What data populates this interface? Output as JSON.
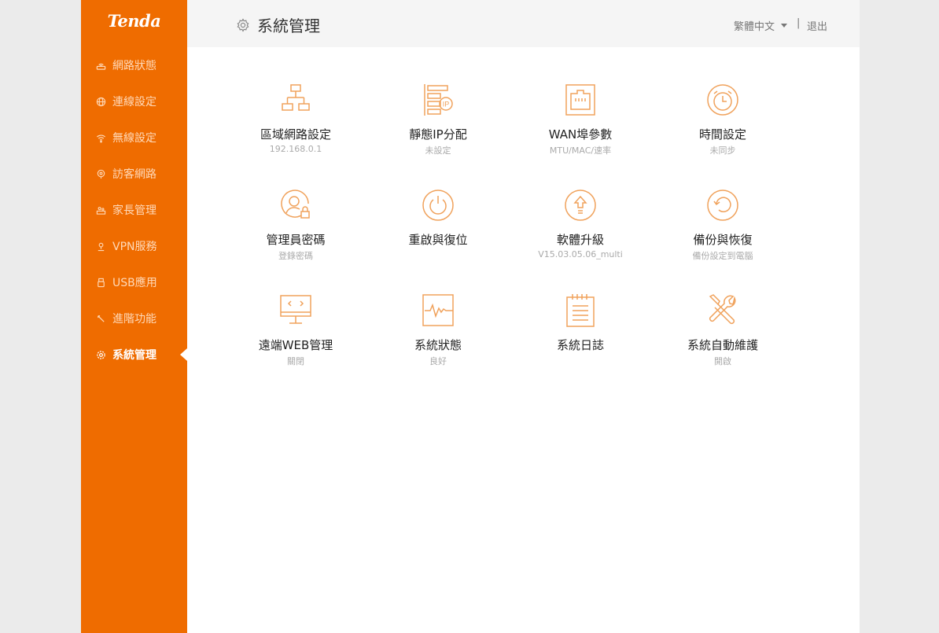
{
  "brand": {
    "logo": "Tenda",
    "accent": "#ef6c00",
    "icon_color": "#f0a25c"
  },
  "sidebar": {
    "items": [
      {
        "label": "網路狀態",
        "icon": "router-icon",
        "active": false
      },
      {
        "label": "連線設定",
        "icon": "globe-icon",
        "active": false
      },
      {
        "label": "無線設定",
        "icon": "wifi-icon",
        "active": false
      },
      {
        "label": "訪客網路",
        "icon": "guest-icon",
        "active": false
      },
      {
        "label": "家長管理",
        "icon": "parental-icon",
        "active": false
      },
      {
        "label": "VPN服務",
        "icon": "vpn-icon",
        "active": false
      },
      {
        "label": "USB應用",
        "icon": "usb-icon",
        "active": false
      },
      {
        "label": "進階功能",
        "icon": "tools-icon",
        "active": false
      },
      {
        "label": "系統管理",
        "icon": "gear-icon",
        "active": true
      }
    ]
  },
  "header": {
    "title": "系統管理",
    "language": "繁體中文",
    "separator": "|",
    "logout": "退出"
  },
  "tiles": [
    {
      "label": "區域網路設定",
      "sub": "192.168.0.1",
      "icon": "lan-topology-icon"
    },
    {
      "label": "靜態IP分配",
      "sub": "未設定",
      "icon": "static-ip-icon"
    },
    {
      "label": "WAN埠參數",
      "sub": "MTU/MAC/速率",
      "icon": "ethernet-port-icon"
    },
    {
      "label": "時間設定",
      "sub": "未同步",
      "icon": "alarm-clock-icon"
    },
    {
      "label": "管理員密碼",
      "sub": "登錄密碼",
      "icon": "admin-lock-icon"
    },
    {
      "label": "重啟與復位",
      "sub": "",
      "icon": "power-icon"
    },
    {
      "label": "軟體升級",
      "sub": "V15.03.05.06_multi",
      "icon": "upgrade-arrow-icon"
    },
    {
      "label": "備份與恢復",
      "sub": "備份設定到電腦",
      "icon": "restore-icon"
    },
    {
      "label": "遠端WEB管理",
      "sub": "關閉",
      "icon": "remote-monitor-icon"
    },
    {
      "label": "系統狀態",
      "sub": "良好",
      "icon": "pulse-icon"
    },
    {
      "label": "系統日誌",
      "sub": "",
      "icon": "log-notepad-icon"
    },
    {
      "label": "系統自動維護",
      "sub": "開啟",
      "icon": "wrench-screwdriver-icon"
    }
  ]
}
